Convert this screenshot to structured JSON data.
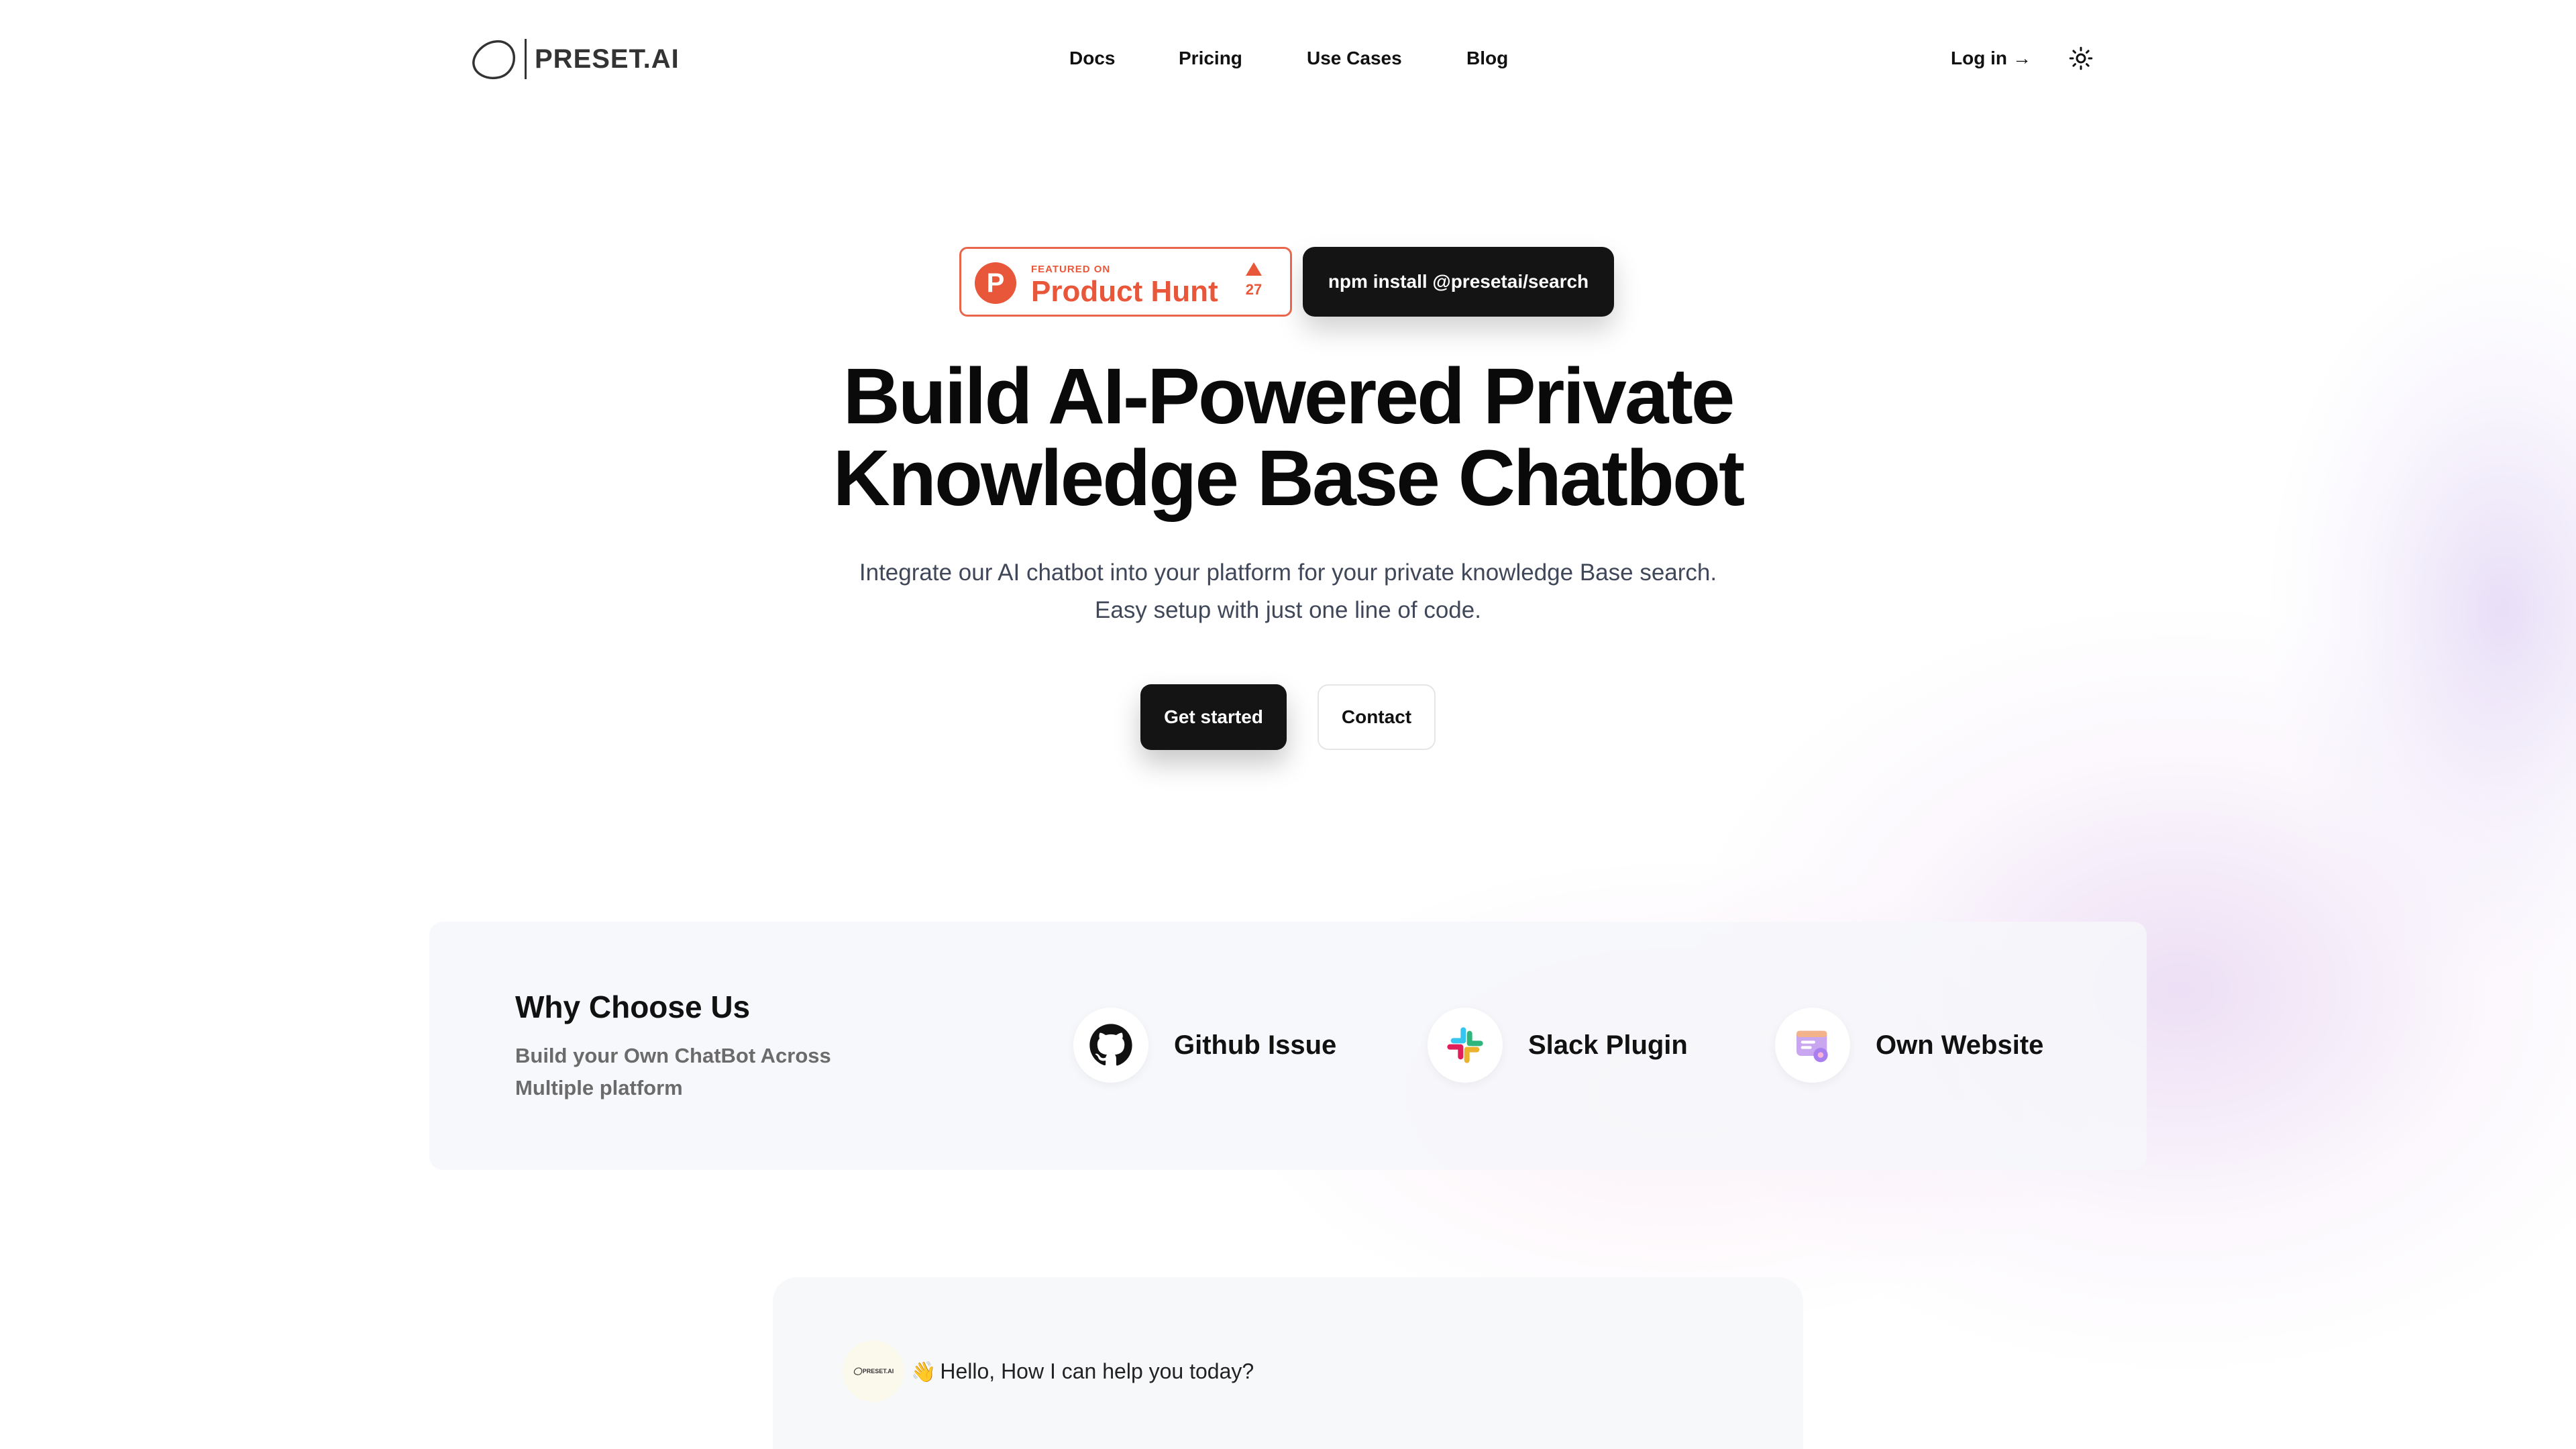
{
  "nav": {
    "logo_text": "PRESET.AI",
    "links": [
      {
        "label": "Docs"
      },
      {
        "label": "Pricing"
      },
      {
        "label": "Use Cases"
      },
      {
        "label": "Blog"
      }
    ],
    "login_label": "Log in",
    "login_arrow": "→",
    "theme_icon": "sun-icon"
  },
  "hero": {
    "product_hunt": {
      "featured_on": "FEATURED ON",
      "name": "Product Hunt",
      "upvotes": "27",
      "logo_letter": "P"
    },
    "npm_command": "npm install @presetai/search",
    "title_line1": "Build AI-Powered Private",
    "title_line2": "Knowledge Base Chatbot",
    "subtitle_line1": "Integrate our AI chatbot into your platform for your private knowledge Base search.",
    "subtitle_line2": "Easy setup with just one line of code.",
    "primary_cta": "Get started",
    "secondary_cta": "Contact"
  },
  "why": {
    "title": "Why Choose Us",
    "subtitle": "Build your Own ChatBot Across Multiple platform",
    "features": [
      {
        "label": "Github Issue",
        "icon": "github-icon"
      },
      {
        "label": "Slack Plugin",
        "icon": "slack-icon"
      },
      {
        "label": "Own Website",
        "icon": "website-icon"
      }
    ]
  },
  "chat": {
    "avatar_text": "PRESET.AI",
    "wave": "👋",
    "greeting": "Hello, How I can help you today?"
  },
  "colors": {
    "brand_dark": "#141414",
    "product_hunt": "#e9573a",
    "subtitle_text": "#3f4759",
    "muted_text": "#6b6b6b",
    "panel_bg": "#f6f7fa"
  }
}
